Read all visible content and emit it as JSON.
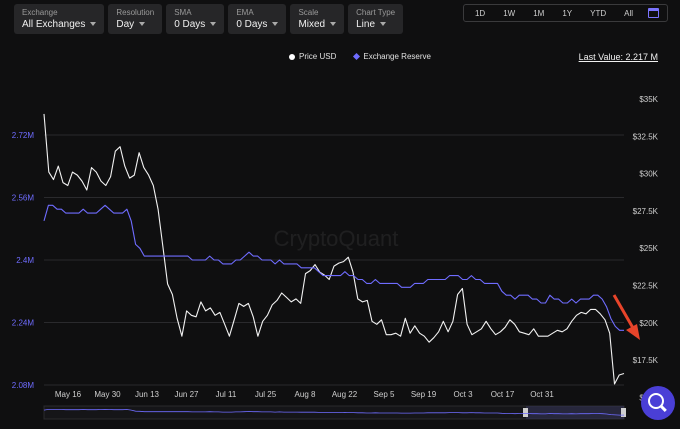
{
  "controls": [
    {
      "label": "Exchange",
      "value": "All Exchanges"
    },
    {
      "label": "Resolution",
      "value": "Day"
    },
    {
      "label": "SMA",
      "value": "0 Days"
    },
    {
      "label": "EMA",
      "value": "0 Days"
    },
    {
      "label": "Scale",
      "value": "Mixed"
    },
    {
      "label": "Chart Type",
      "value": "Line"
    }
  ],
  "ranges": [
    "1D",
    "1W",
    "1M",
    "1Y",
    "YTD",
    "All"
  ],
  "last_value": "Last Value: 2.217 M",
  "watermark": "CryptoQuant",
  "colors": {
    "price": "#f2f2f2",
    "reserve": "#6f6cff",
    "arrow": "#e8442a",
    "accent": "#4a3fd6"
  },
  "icons": {
    "date_picker": "calendar-icon",
    "fab": "search-icon",
    "annotation": "red-arrow-icon"
  },
  "chart_data": {
    "type": "line",
    "legend": [
      "Price USD",
      "Exchange Reserve"
    ],
    "x_ticks": [
      "May 16",
      "May 30",
      "Jun 13",
      "Jun 27",
      "Jul 11",
      "Jul 25",
      "Aug 8",
      "Aug 22",
      "Sep 5",
      "Sep 19",
      "Oct 3",
      "Oct 17",
      "Oct 31"
    ],
    "y_left": {
      "ticks": [
        "2.72M",
        "2.56M",
        "2.4M",
        "2.24M",
        "2.08M"
      ],
      "values": [
        2.72,
        2.56,
        2.4,
        2.24,
        2.08
      ],
      "unit": "M"
    },
    "y_right": {
      "ticks": [
        "$35K",
        "$32.5K",
        "$30K",
        "$27.5K",
        "$25K",
        "$22.5K",
        "$20K",
        "$17.5K",
        "$15K"
      ],
      "values": [
        35,
        32.5,
        30,
        27.5,
        25,
        22.5,
        20,
        17.5,
        15
      ],
      "unit": "K"
    },
    "series": [
      {
        "name": "Exchange Reserve",
        "axis": "left",
        "values": [
          2.5,
          2.54,
          2.54,
          2.53,
          2.53,
          2.52,
          2.52,
          2.52,
          2.52,
          2.53,
          2.52,
          2.52,
          2.52,
          2.53,
          2.54,
          2.53,
          2.52,
          2.52,
          2.52,
          2.53,
          2.5,
          2.44,
          2.43,
          2.41,
          2.41,
          2.41,
          2.41,
          2.41,
          2.41,
          2.41,
          2.41,
          2.41,
          2.41,
          2.41,
          2.4,
          2.4,
          2.4,
          2.4,
          2.41,
          2.4,
          2.4,
          2.39,
          2.39,
          2.39,
          2.4,
          2.4,
          2.41,
          2.42,
          2.41,
          2.41,
          2.4,
          2.4,
          2.4,
          2.39,
          2.4,
          2.39,
          2.39,
          2.39,
          2.39,
          2.38,
          2.38,
          2.38,
          2.38,
          2.37,
          2.36,
          2.36,
          2.36,
          2.36,
          2.36,
          2.37,
          2.36,
          2.36,
          2.35,
          2.35,
          2.34,
          2.34,
          2.35,
          2.34,
          2.34,
          2.34,
          2.34,
          2.34,
          2.33,
          2.33,
          2.33,
          2.34,
          2.34,
          2.34,
          2.35,
          2.35,
          2.35,
          2.35,
          2.35,
          2.36,
          2.36,
          2.36,
          2.35,
          2.35,
          2.36,
          2.35,
          2.35,
          2.34,
          2.34,
          2.34,
          2.34,
          2.32,
          2.31,
          2.31,
          2.3,
          2.31,
          2.31,
          2.31,
          2.3,
          2.3,
          2.29,
          2.29,
          2.31,
          2.3,
          2.3,
          2.29,
          2.29,
          2.3,
          2.29,
          2.3,
          2.3,
          2.3,
          2.31,
          2.31,
          2.3,
          2.28,
          2.25,
          2.23,
          2.22,
          2.22
        ]
      },
      {
        "name": "Price USD",
        "axis": "right",
        "values": [
          34,
          30.1,
          29.6,
          30.5,
          29.4,
          29.2,
          30.1,
          29.9,
          29.5,
          28.9,
          30.4,
          30.1,
          29.5,
          29.2,
          29.8,
          31.5,
          31.8,
          30.5,
          29.7,
          29.9,
          31.4,
          30.4,
          29.9,
          29.2,
          27.6,
          25.1,
          22.6,
          21.9,
          20.3,
          19.1,
          20.8,
          20.5,
          20.4,
          21.4,
          20.8,
          21,
          20.5,
          20.7,
          19.9,
          19.1,
          20.2,
          21.3,
          21.1,
          21.3,
          20.4,
          19.1,
          20.1,
          20.5,
          21.2,
          21.5,
          22,
          21.7,
          21.4,
          21.6,
          21.3,
          23.3,
          23.5,
          23.9,
          23.4,
          23.2,
          22.9,
          23.8,
          24,
          24.1,
          24.4,
          23.4,
          21.6,
          21.4,
          21.5,
          20.1,
          19.9,
          20.2,
          19.2,
          19.2,
          19.3,
          19.1,
          20.3,
          19.3,
          19.8,
          19.3,
          19.1,
          18.7,
          19,
          19.4,
          20.1,
          19.4,
          20.1,
          21.9,
          22.3,
          19.9,
          19.2,
          19.4,
          19.6,
          20.1,
          19.6,
          19.2,
          19.4,
          19.7,
          20.2,
          19.9,
          19.4,
          19.3,
          19.2,
          19.6,
          19.1,
          19.1,
          19.1,
          19.3,
          19.5,
          19.4,
          19.6,
          20.1,
          20.5,
          20.7,
          20.6,
          20.9,
          20.9,
          20.6,
          20.2,
          19.3,
          15.9,
          16.5,
          16.6
        ]
      }
    ]
  }
}
